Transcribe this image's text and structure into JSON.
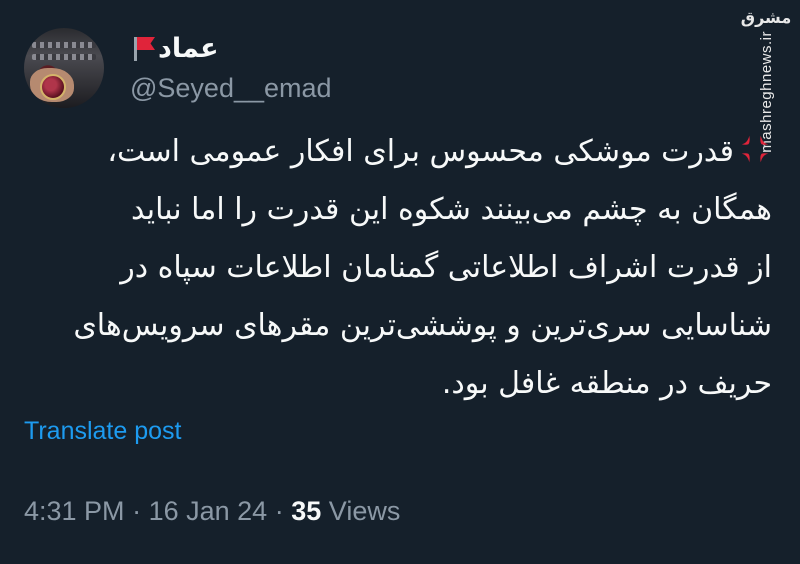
{
  "author": {
    "display_name": "عماد",
    "flag_icon": "red-flag-icon",
    "handle": "@Seyed__emad"
  },
  "watermark": {
    "logo_text": "مشرق",
    "site": "mashreghnews.ir"
  },
  "tweet": {
    "lead_icon": "anger-symbol-icon",
    "lines": [
      "قدرت موشکی محسوس برای افکار عمومی است،",
      "همگان به چشم می‌بینند شکوه این قدرت را اما نباید",
      "از قدرت اشراف اطلاعاتی گمنامان اطلاعات سپاه در",
      "شناسایی سری‌ترین و پوششی‌ترین مقرهای سرویس‌های",
      "حریف در منطقه غافل بود."
    ]
  },
  "translate_label": "Translate post",
  "meta": {
    "time": "4:31 PM",
    "separator": "·",
    "date": "16 Jan 24",
    "views_count": "35",
    "views_label": "Views"
  },
  "colors": {
    "background": "#15202b",
    "primary_text": "#f7f9f9",
    "secondary_text": "#8b98a5",
    "link": "#1d9bf0"
  }
}
